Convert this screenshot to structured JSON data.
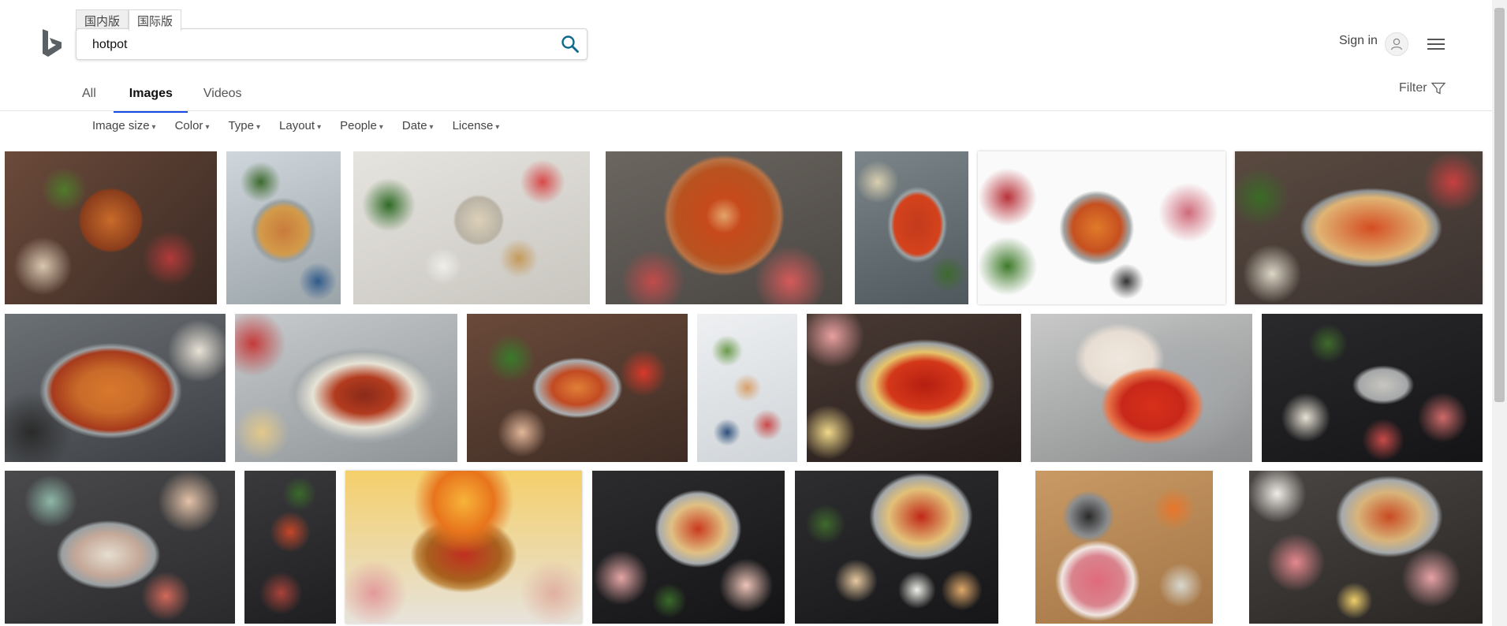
{
  "region_tabs": [
    "国内版",
    "国际版"
  ],
  "search": {
    "value": "hotpot",
    "placeholder": ""
  },
  "header": {
    "signin_label": "Sign in"
  },
  "nav_tabs": [
    "All",
    "Images",
    "Videos"
  ],
  "active_tab": "Images",
  "filter_label": "Filter",
  "filters": [
    "Image size",
    "Color",
    "Type",
    "Layout",
    "People",
    "Date",
    "License"
  ],
  "colors": {
    "accent": "#174ae4",
    "search_icon": "#0b6a8b"
  },
  "images": [
    {
      "row": 1,
      "name": "hotpot-table-spread"
    },
    {
      "row": 1,
      "name": "split-pot-topdown"
    },
    {
      "row": 1,
      "name": "dumplings-broth-spread"
    },
    {
      "row": 1,
      "name": "copper-pot-dip"
    },
    {
      "row": 1,
      "name": "red-broth-chopsticks"
    },
    {
      "row": 1,
      "name": "yin-yang-pot-meats"
    },
    {
      "row": 1,
      "name": "divided-pot-veggies"
    },
    {
      "row": 2,
      "name": "two-broth-pot-closeup"
    },
    {
      "row": 2,
      "name": "clear-and-chili-broth"
    },
    {
      "row": 2,
      "name": "seafood-hotpot-feast"
    },
    {
      "row": 2,
      "name": "tall-table-layout"
    },
    {
      "row": 2,
      "name": "chili-oil-pot"
    },
    {
      "row": 2,
      "name": "bubbling-divided-pot"
    },
    {
      "row": 2,
      "name": "restaurant-hotpot-set"
    },
    {
      "row": 3,
      "name": "family-hotpot-dinner"
    },
    {
      "row": 3,
      "name": "narrow-dark-table"
    },
    {
      "row": 3,
      "name": "flaming-hotpot-art"
    },
    {
      "row": 3,
      "name": "meat-platters-pot"
    },
    {
      "row": 3,
      "name": "sauces-and-pot"
    },
    {
      "row": 3,
      "name": "lamb-rolls-plate"
    },
    {
      "row": 3,
      "name": "buffet-hotpot-spread"
    }
  ]
}
